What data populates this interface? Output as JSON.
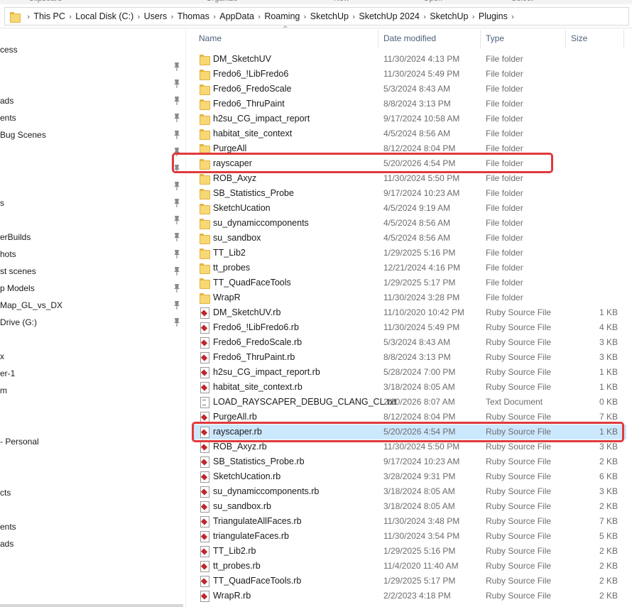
{
  "ribbon": {
    "groups": [
      "Clipboard",
      "Organize",
      "New",
      "Open",
      "Select"
    ]
  },
  "address": {
    "icon": "folder-icon",
    "crumbs": [
      "This PC",
      "Local Disk (C:)",
      "Users",
      "Thomas",
      "AppData",
      "Roaming",
      "SketchUp",
      "SketchUp 2024",
      "SketchUp",
      "Plugins"
    ]
  },
  "nav": {
    "items": [
      {
        "label": "cess",
        "pinned": false
      },
      {
        "label": "",
        "pinned": true
      },
      {
        "label": "",
        "pinned": true
      },
      {
        "label": "ads",
        "pinned": true
      },
      {
        "label": "ents",
        "pinned": true
      },
      {
        "label": "Bug Scenes",
        "pinned": true
      },
      {
        "label": "",
        "pinned": true
      },
      {
        "label": "",
        "pinned": true
      },
      {
        "label": "",
        "pinned": true
      },
      {
        "label": "s",
        "pinned": true
      },
      {
        "label": "",
        "pinned": true
      },
      {
        "label": "erBuilds",
        "pinned": true
      },
      {
        "label": "hots",
        "pinned": true
      },
      {
        "label": "st scenes",
        "pinned": true
      },
      {
        "label": "p Models",
        "pinned": true
      },
      {
        "label": "Map_GL_vs_DX",
        "pinned": true
      },
      {
        "label": "Drive (G:)",
        "pinned": true
      },
      {
        "label": "",
        "pinned": false
      },
      {
        "label": "x",
        "pinned": false
      },
      {
        "label": "er-1",
        "pinned": false
      },
      {
        "label": "m",
        "pinned": false
      },
      {
        "label": "",
        "pinned": false
      },
      {
        "label": "",
        "pinned": false
      },
      {
        "label": " - Personal",
        "pinned": false
      },
      {
        "label": "",
        "pinned": false
      },
      {
        "label": "",
        "pinned": false
      },
      {
        "label": "cts",
        "pinned": false
      },
      {
        "label": "",
        "pinned": false
      },
      {
        "label": "ents",
        "pinned": false
      },
      {
        "label": "ads",
        "pinned": false
      }
    ]
  },
  "columns": {
    "name": "Name",
    "date": "Date modified",
    "type": "Type",
    "size": "Size"
  },
  "files": [
    {
      "name": "DM_SketchUV",
      "date": "11/30/2024 4:13 PM",
      "type": "File folder",
      "size": "",
      "kind": "folder"
    },
    {
      "name": "Fredo6_!LibFredo6",
      "date": "11/30/2024 5:49 PM",
      "type": "File folder",
      "size": "",
      "kind": "folder"
    },
    {
      "name": "Fredo6_FredoScale",
      "date": "5/3/2024 8:43 AM",
      "type": "File folder",
      "size": "",
      "kind": "folder"
    },
    {
      "name": "Fredo6_ThruPaint",
      "date": "8/8/2024 3:13 PM",
      "type": "File folder",
      "size": "",
      "kind": "folder"
    },
    {
      "name": "h2su_CG_impact_report",
      "date": "9/17/2024 10:58 AM",
      "type": "File folder",
      "size": "",
      "kind": "folder"
    },
    {
      "name": "habitat_site_context",
      "date": "4/5/2024 8:56 AM",
      "type": "File folder",
      "size": "",
      "kind": "folder"
    },
    {
      "name": "PurgeAll",
      "date": "8/12/2024 8:04 PM",
      "type": "File folder",
      "size": "",
      "kind": "folder"
    },
    {
      "name": "rayscaper",
      "date": "5/20/2026 4:54 PM",
      "type": "File folder",
      "size": "",
      "kind": "folder"
    },
    {
      "name": "ROB_Axyz",
      "date": "11/30/2024 5:50 PM",
      "type": "File folder",
      "size": "",
      "kind": "folder"
    },
    {
      "name": "SB_Statistics_Probe",
      "date": "9/17/2024 10:23 AM",
      "type": "File folder",
      "size": "",
      "kind": "folder"
    },
    {
      "name": "SketchUcation",
      "date": "4/5/2024 9:19 AM",
      "type": "File folder",
      "size": "",
      "kind": "folder"
    },
    {
      "name": "su_dynamiccomponents",
      "date": "4/5/2024 8:56 AM",
      "type": "File folder",
      "size": "",
      "kind": "folder"
    },
    {
      "name": "su_sandbox",
      "date": "4/5/2024 8:56 AM",
      "type": "File folder",
      "size": "",
      "kind": "folder"
    },
    {
      "name": "TT_Lib2",
      "date": "1/29/2025 5:16 PM",
      "type": "File folder",
      "size": "",
      "kind": "folder"
    },
    {
      "name": "tt_probes",
      "date": "12/21/2024 4:16 PM",
      "type": "File folder",
      "size": "",
      "kind": "folder"
    },
    {
      "name": "TT_QuadFaceTools",
      "date": "1/29/2025 5:17 PM",
      "type": "File folder",
      "size": "",
      "kind": "folder"
    },
    {
      "name": "WrapR",
      "date": "11/30/2024 3:28 PM",
      "type": "File folder",
      "size": "",
      "kind": "folder"
    },
    {
      "name": "DM_SketchUV.rb",
      "date": "11/10/2020 10:42 PM",
      "type": "Ruby Source File",
      "size": "1 KB",
      "kind": "rb"
    },
    {
      "name": "Fredo6_!LibFredo6.rb",
      "date": "11/30/2024 5:49 PM",
      "type": "Ruby Source File",
      "size": "4 KB",
      "kind": "rb"
    },
    {
      "name": "Fredo6_FredoScale.rb",
      "date": "5/3/2024 8:43 AM",
      "type": "Ruby Source File",
      "size": "3 KB",
      "kind": "rb"
    },
    {
      "name": "Fredo6_ThruPaint.rb",
      "date": "8/8/2024 3:13 PM",
      "type": "Ruby Source File",
      "size": "3 KB",
      "kind": "rb"
    },
    {
      "name": "h2su_CG_impact_report.rb",
      "date": "5/28/2024 7:00 PM",
      "type": "Ruby Source File",
      "size": "1 KB",
      "kind": "rb"
    },
    {
      "name": "habitat_site_context.rb",
      "date": "3/18/2024 8:05 AM",
      "type": "Ruby Source File",
      "size": "1 KB",
      "kind": "rb"
    },
    {
      "name": "LOAD_RAYSCAPER_DEBUG_CLANG_CL.txt",
      "date": "2/20/2026 8:07 AM",
      "type": "Text Document",
      "size": "0 KB",
      "kind": "txt"
    },
    {
      "name": "PurgeAll.rb",
      "date": "8/12/2024 8:04 PM",
      "type": "Ruby Source File",
      "size": "7 KB",
      "kind": "rb"
    },
    {
      "name": "rayscaper.rb",
      "date": "5/20/2026 4:54 PM",
      "type": "Ruby Source File",
      "size": "1 KB",
      "kind": "rb",
      "selected": true
    },
    {
      "name": "ROB_Axyz.rb",
      "date": "11/30/2024 5:50 PM",
      "type": "Ruby Source File",
      "size": "3 KB",
      "kind": "rb"
    },
    {
      "name": "SB_Statistics_Probe.rb",
      "date": "9/17/2024 10:23 AM",
      "type": "Ruby Source File",
      "size": "2 KB",
      "kind": "rb"
    },
    {
      "name": "SketchUcation.rb",
      "date": "3/28/2024 9:31 PM",
      "type": "Ruby Source File",
      "size": "6 KB",
      "kind": "rb"
    },
    {
      "name": "su_dynamiccomponents.rb",
      "date": "3/18/2024 8:05 AM",
      "type": "Ruby Source File",
      "size": "3 KB",
      "kind": "rb"
    },
    {
      "name": "su_sandbox.rb",
      "date": "3/18/2024 8:05 AM",
      "type": "Ruby Source File",
      "size": "2 KB",
      "kind": "rb"
    },
    {
      "name": "TriangulateAllFaces.rb",
      "date": "11/30/2024 3:48 PM",
      "type": "Ruby Source File",
      "size": "7 KB",
      "kind": "rb"
    },
    {
      "name": "triangulateFaces.rb",
      "date": "11/30/2024 3:54 PM",
      "type": "Ruby Source File",
      "size": "5 KB",
      "kind": "rb"
    },
    {
      "name": "TT_Lib2.rb",
      "date": "1/29/2025 5:16 PM",
      "type": "Ruby Source File",
      "size": "2 KB",
      "kind": "rb"
    },
    {
      "name": "tt_probes.rb",
      "date": "11/4/2020 11:40 AM",
      "type": "Ruby Source File",
      "size": "2 KB",
      "kind": "rb"
    },
    {
      "name": "TT_QuadFaceTools.rb",
      "date": "1/29/2025 5:17 PM",
      "type": "Ruby Source File",
      "size": "2 KB",
      "kind": "rb"
    },
    {
      "name": "WrapR.rb",
      "date": "2/2/2023 4:18 PM",
      "type": "Ruby Source File",
      "size": "2 KB",
      "kind": "rb"
    }
  ],
  "colors": {
    "highlight_box": "#e0393c",
    "selected_row": "#cce8ff",
    "folder": "#f8d775",
    "ruby": "#c0262c"
  }
}
